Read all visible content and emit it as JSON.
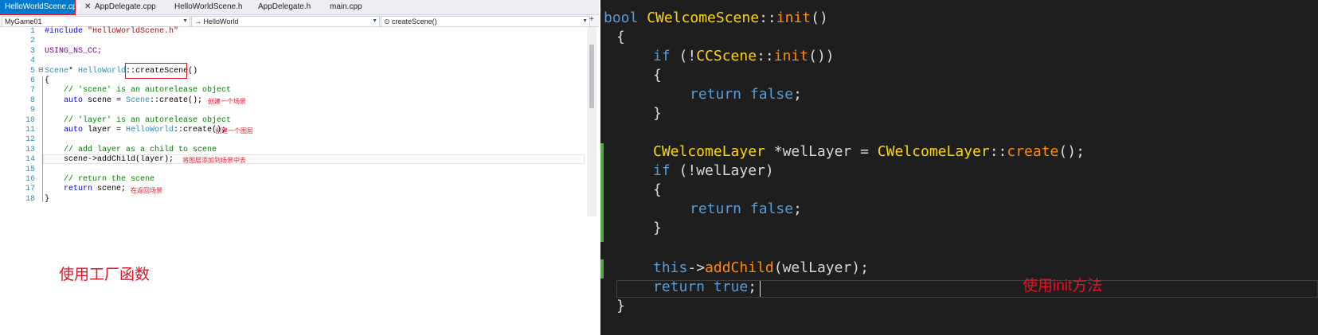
{
  "left": {
    "tabs": [
      {
        "label": "HelloWorldScene.cpp",
        "active": true
      },
      {
        "label": "AppDelegate.cpp",
        "active": false
      },
      {
        "label": "HelloWorldScene.h",
        "active": false
      },
      {
        "label": "AppDelegate.h",
        "active": false
      },
      {
        "label": "main.cpp",
        "active": false
      }
    ],
    "tab_pin_icon": "pin-icon",
    "tab_close_glyph": "✕",
    "nav": {
      "project": "MyGame01",
      "scope": "→ HelloWorld",
      "member": "⊙ createScene()"
    },
    "line_numbers": [
      "1",
      "2",
      "3",
      "4",
      "5",
      "6",
      "7",
      "8",
      "9",
      "10",
      "11",
      "12",
      "13",
      "14",
      "15",
      "16",
      "17",
      "18"
    ],
    "code": {
      "l1_kw": "#include",
      "l1_str": " \"HelloWorldScene.h\"",
      "l3_macro": "USING_NS_CC;",
      "l5_type": "Scene",
      "l5_star": "* ",
      "l5_cls": "HelloWorld",
      "l5_sep": "::",
      "l5_fn": "createScene",
      "l5_paren": "()",
      "l6": "{",
      "l7_cm": "// 'scene' is an autorelease object",
      "l8_kw": "auto",
      "l8_a": " scene = ",
      "l8_ty": "Scene",
      "l8_b": "::create();",
      "l10_cm": "// 'layer' is an autorelease object",
      "l11_kw": "auto",
      "l11_a": " layer = ",
      "l11_ty": "HelloWorld",
      "l11_b": "::create();",
      "l13_cm": "// add layer as a child to scene",
      "l14": "scene->addChild(layer);",
      "l16_cm": "// return the scene",
      "l17_kw": "return",
      "l17_a": " scene;",
      "l18": "}"
    },
    "annotations": {
      "create_scene": "创建一个场景",
      "create_layer": "创建一个图层",
      "add_layer": "将图层添加到场景中去",
      "return_scene": "在返回场景"
    },
    "caption": "使用工厂函数"
  },
  "right": {
    "code": {
      "r1_kw": "bool ",
      "r1_cls": "CWelcomeScene",
      "r1_sep": "::",
      "r1_fn": "init",
      "r1_paren": "()",
      "r2": "{",
      "r3_kw": "if",
      "r3_a": " (!",
      "r3_cls": "CCScene",
      "r3_sep": "::",
      "r3_fn": "init",
      "r3_b": "())",
      "r4": "{",
      "r5_kw": "return",
      "r5_val": " false",
      "r5_semi": ";",
      "r6": "}",
      "r8_cls": "CWelcomeLayer",
      "r8_a": " *",
      "r8_var": "welLayer",
      "r8_b": " = ",
      "r8_cls2": "CWelcomeLayer",
      "r8_sep": "::",
      "r8_fn": "create",
      "r8_c": "();",
      "r9_kw": "if",
      "r9_a": " (!",
      "r9_var": "welLayer",
      "r9_b": ")",
      "r10": "{",
      "r11_kw": "return",
      "r11_val": " false",
      "r11_semi": ";",
      "r12": "}",
      "r14_kw": "this",
      "r14_a": "->",
      "r14_fn": "addChild",
      "r14_b": "(",
      "r14_var": "welLayer",
      "r14_c": ");",
      "r15_kw": "return",
      "r15_val": " true",
      "r15_semi": ";",
      "r16": "}"
    },
    "caption": "使用init方法"
  },
  "colors": {
    "accent_tab": "#007acc",
    "annotation_red": "#e81123",
    "dark_bg": "#1e1e1e",
    "keyword_dark": "#569cd6",
    "type_dark": "#ffd700",
    "function_dark": "#ff8c00",
    "change_bar": "#57a64a"
  }
}
